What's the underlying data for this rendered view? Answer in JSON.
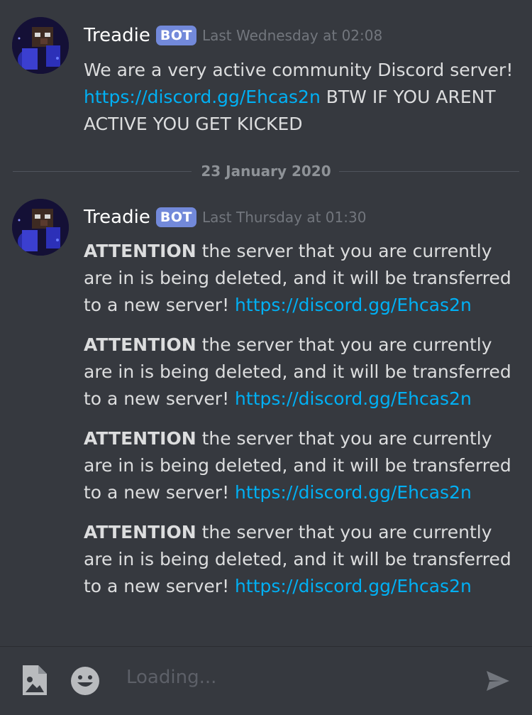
{
  "messages": [
    {
      "username": "Treadie",
      "badge": "BOT",
      "timestamp": "Last Wednesday at 02:08",
      "text_part1": "We are a very active community Discord server!",
      "link": "https://discord.gg/Ehcas2n",
      "text_part2": " BTW IF YOU ARENT ACTIVE YOU GET KICKED"
    }
  ],
  "date_divider": "23 January 2020",
  "group2": {
    "username": "Treadie",
    "badge": "BOT",
    "timestamp": "Last Thursday at 01:30",
    "posts": [
      {
        "bold": "ATTENTION",
        "text": " the server that you are currently are in is being deleted, and it will be transferred to a new server!",
        "link": "https://discord.gg/Ehcas2n"
      },
      {
        "bold": "ATTENTION",
        "text": " the server that you are currently are in is being deleted, and it will be transferred to a new server!",
        "link": "https://discord.gg/Ehcas2n"
      },
      {
        "bold": "ATTENTION",
        "text": " the server that you are currently are in is being deleted, and it will be transferred to a new server!",
        "link": "https://discord.gg/Ehcas2n"
      },
      {
        "bold": "ATTENTION",
        "text": " the server that you are currently are in is being deleted, and it will be transferred to a new server!",
        "link": "https://discord.gg/Ehcas2n"
      }
    ]
  },
  "composer": {
    "placeholder": "Loading...",
    "icons": [
      "image-upload-icon",
      "emoji-icon",
      "send-icon"
    ]
  },
  "colors": {
    "background": "#36393f",
    "link": "#00b0f4",
    "bot_badge": "#7289da",
    "timestamp": "#72767d"
  }
}
